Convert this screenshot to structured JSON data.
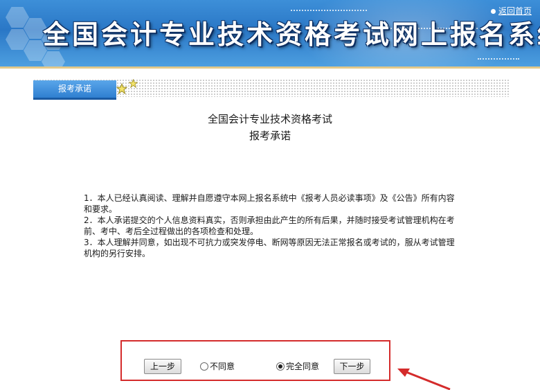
{
  "header": {
    "title": "全国会计专业技术资格考试网上报名系统",
    "home_link": "返回首页"
  },
  "section": {
    "tab_label": "报考承诺"
  },
  "document": {
    "title": "全国会计专业技术资格考试",
    "subtitle": "报考承诺",
    "lines": [
      "1．本人已经认真阅读、理解并自愿遵守本网上报名系统中《报考人员必读事项》及《公告》所有内容",
      "和要求。",
      "2．本人承诺提交的个人信息资料真实，否则承担由此产生的所有后果，并随时接受考试管理机构在考",
      "前、考中、考后全过程做出的各项检查和处理。",
      "3．本人理解并同意，如出现不可抗力或突发停电、断网等原因无法正常报名或考试的，服从考试管理",
      "机构的另行安排。"
    ]
  },
  "actions": {
    "prev_label": "上一步",
    "disagree_label": "不同意",
    "agree_label": "完全同意",
    "next_label": "下一步",
    "selected": "agree"
  },
  "colors": {
    "banner": "#2a77c6",
    "tab": "#3b8ddc",
    "highlight_box": "#d42b2b",
    "arrow": "#d42b2b"
  }
}
